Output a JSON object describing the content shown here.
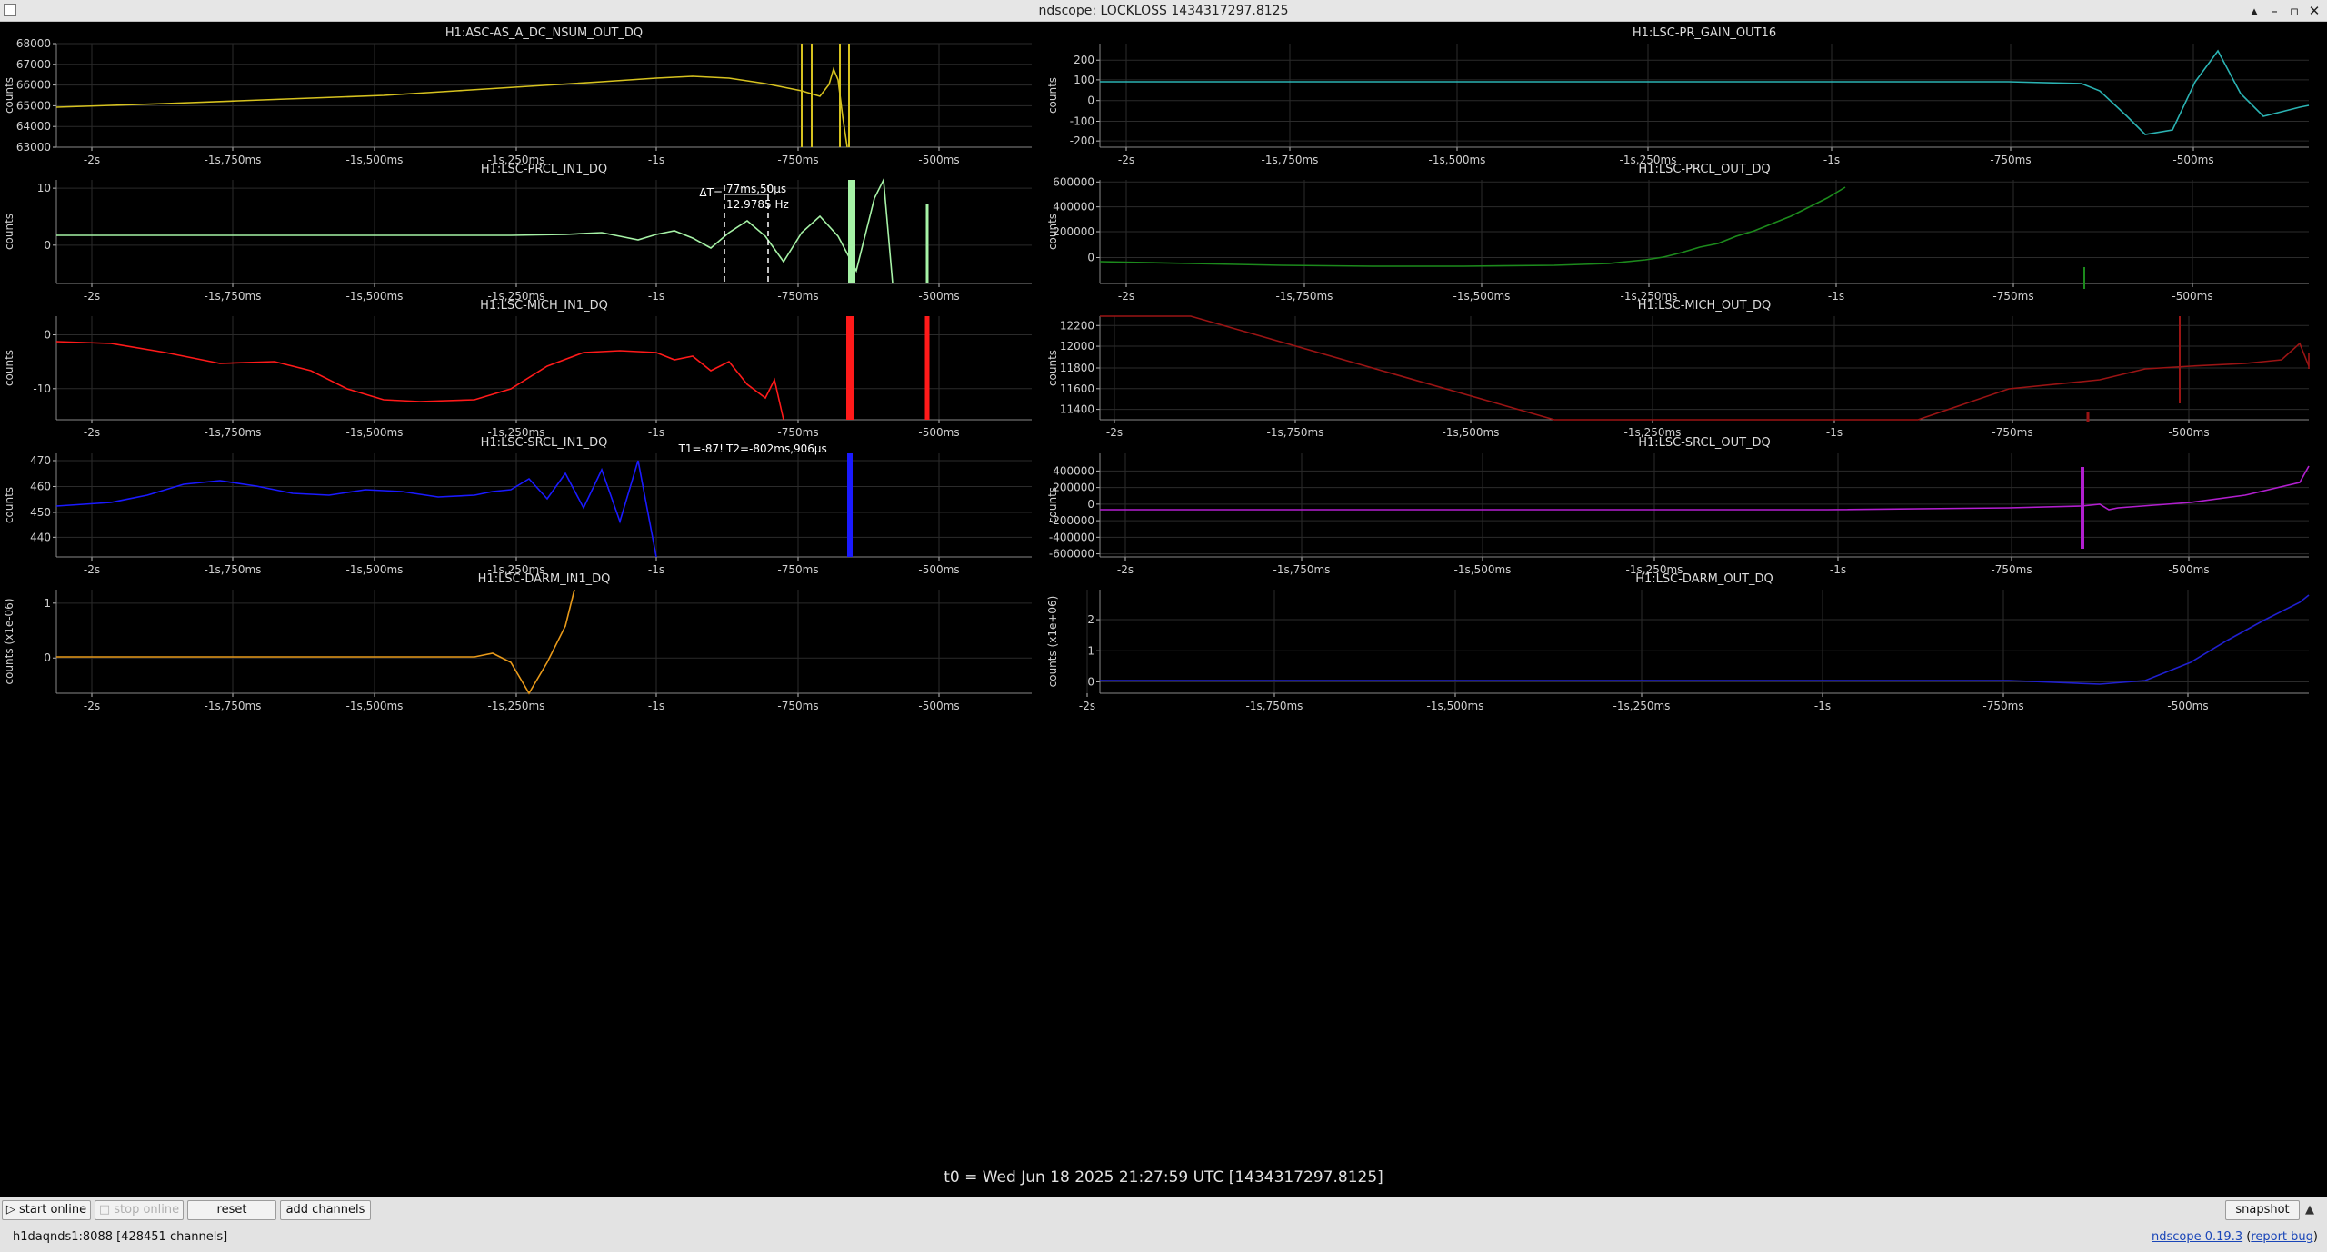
{
  "window": {
    "title": "ndscope: LOCKLOSS 1434317297.8125"
  },
  "window_controls": [
    "▴",
    "–",
    "▫",
    "✕"
  ],
  "time_axis": {
    "ticks": [
      {
        "t": -2.0,
        "label": "-2s"
      },
      {
        "t": -1.75,
        "label": "-1s,750ms"
      },
      {
        "t": -1.5,
        "label": "-1s,500ms"
      },
      {
        "t": -1.25,
        "label": "-1s,250ms"
      },
      {
        "t": -1.0,
        "label": "-1s"
      },
      {
        "t": -0.75,
        "label": "-750ms"
      },
      {
        "t": -0.5,
        "label": "-500ms"
      }
    ]
  },
  "plots": [
    {
      "channel": "H1:ASC-AS_A_DC_NSUM_OUT_DQ",
      "ylabel": "counts",
      "yticks": [
        "68000",
        "67000",
        "66000",
        "65000",
        "64000",
        "63000"
      ],
      "color": "#d6c21f"
    },
    {
      "channel": "H1:LSC-PR_GAIN_OUT16",
      "ylabel": "counts",
      "yticks": [
        "200",
        "100",
        "0",
        "-100",
        "-200"
      ],
      "color": "#2bb3b3"
    },
    {
      "channel": "H1:LSC-PRCL_IN1_DQ",
      "ylabel": "counts",
      "yticks": [
        "10",
        "0"
      ],
      "color": "#a6f2a6"
    },
    {
      "channel": "H1:LSC-PRCL_OUT_DQ",
      "ylabel": "counts",
      "yticks": [
        "600000",
        "400000",
        "200000",
        "0"
      ],
      "color": "#1c8a1c"
    },
    {
      "channel": "H1:LSC-MICH_IN1_DQ",
      "ylabel": "counts",
      "yticks": [
        "0",
        "-10"
      ],
      "color": "#ff1a1a"
    },
    {
      "channel": "H1:LSC-MICH_OUT_DQ",
      "ylabel": "counts",
      "yticks": [
        "12200",
        "12000",
        "11800",
        "11600",
        "11400"
      ],
      "color": "#9a1414"
    },
    {
      "channel": "H1:LSC-SRCL_IN1_DQ",
      "ylabel": "counts",
      "yticks": [
        "470",
        "460",
        "450",
        "440"
      ],
      "color": "#1a1aff"
    },
    {
      "channel": "H1:LSC-SRCL_OUT_DQ",
      "ylabel": "counts",
      "yticks": [
        "400000",
        "200000",
        "0",
        "-200000",
        "-400000",
        "-600000"
      ],
      "color": "#b21fcf"
    },
    {
      "channel": "H1:LSC-DARM_IN1_DQ",
      "ylabel": "counts (x1e-06)",
      "yticks": [
        "1",
        "0"
      ],
      "color": "#e89a1a"
    },
    {
      "channel": "H1:LSC-DARM_OUT_DQ",
      "ylabel": "counts (x1e+06)",
      "yticks": [
        "2",
        "1",
        "0"
      ],
      "color": "#2020d0"
    }
  ],
  "cursor": {
    "delta_label": "ΔT=",
    "delta_value": "77ms,50μs",
    "freq": "12.9785 Hz",
    "t1_label": "T1=-87!",
    "t2_label": "T2=-802ms,906μs"
  },
  "t0_label": "t0 = Wed Jun 18 2025 21:27:59 UTC [1434317297.8125]",
  "toolbar": {
    "start_online": "start online",
    "stop_online": "stop online",
    "reset": "reset",
    "add_channels": "add channels",
    "snapshot": "snapshot"
  },
  "status": {
    "server": "h1daqnds1:8088  [428451 channels]"
  },
  "version": {
    "name": "ndscope 0.19.3",
    "open_paren": "(",
    "report": "report bug",
    "close_paren": ")"
  }
}
